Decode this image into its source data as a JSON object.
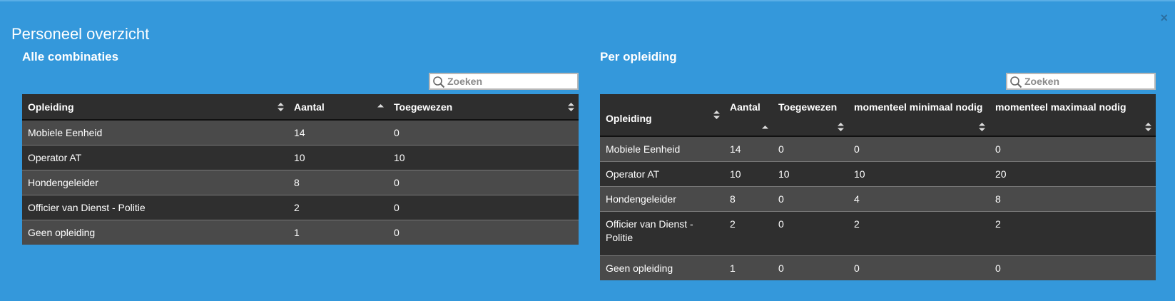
{
  "window": {
    "title": "Personeel overzicht",
    "close_label": "×"
  },
  "left": {
    "subtitle": "Alle combinaties",
    "search_placeholder": "Zoeken",
    "columns": [
      "Opleiding",
      "Aantal",
      "Toegewezen"
    ],
    "rows": [
      [
        "Mobiele Eenheid",
        "14",
        "0"
      ],
      [
        "Operator AT",
        "10",
        "10"
      ],
      [
        "Hondengeleider",
        "8",
        "0"
      ],
      [
        "Officier van Dienst - Politie",
        "2",
        "0"
      ],
      [
        "Geen opleiding",
        "1",
        "0"
      ]
    ]
  },
  "right": {
    "subtitle": "Per opleiding",
    "search_placeholder": "Zoeken",
    "columns": [
      "Opleiding",
      "Aantal",
      "Toegewezen",
      "momenteel minimaal nodig",
      "momenteel maximaal nodig"
    ],
    "rows": [
      [
        "Mobiele Eenheid",
        "14",
        "0",
        "0",
        "0"
      ],
      [
        "Operator AT",
        "10",
        "10",
        "10",
        "20"
      ],
      [
        "Hondengeleider",
        "8",
        "0",
        "4",
        "8"
      ],
      [
        "Officier van Dienst - Politie",
        "2",
        "0",
        "2",
        "2"
      ],
      [
        "Geen opleiding",
        "1",
        "0",
        "0",
        "0"
      ]
    ]
  },
  "colors": {
    "background": "#3498db",
    "header": "#2e2e2e",
    "row_odd": "#4a4a4a",
    "row_even": "#2f2f2f"
  }
}
